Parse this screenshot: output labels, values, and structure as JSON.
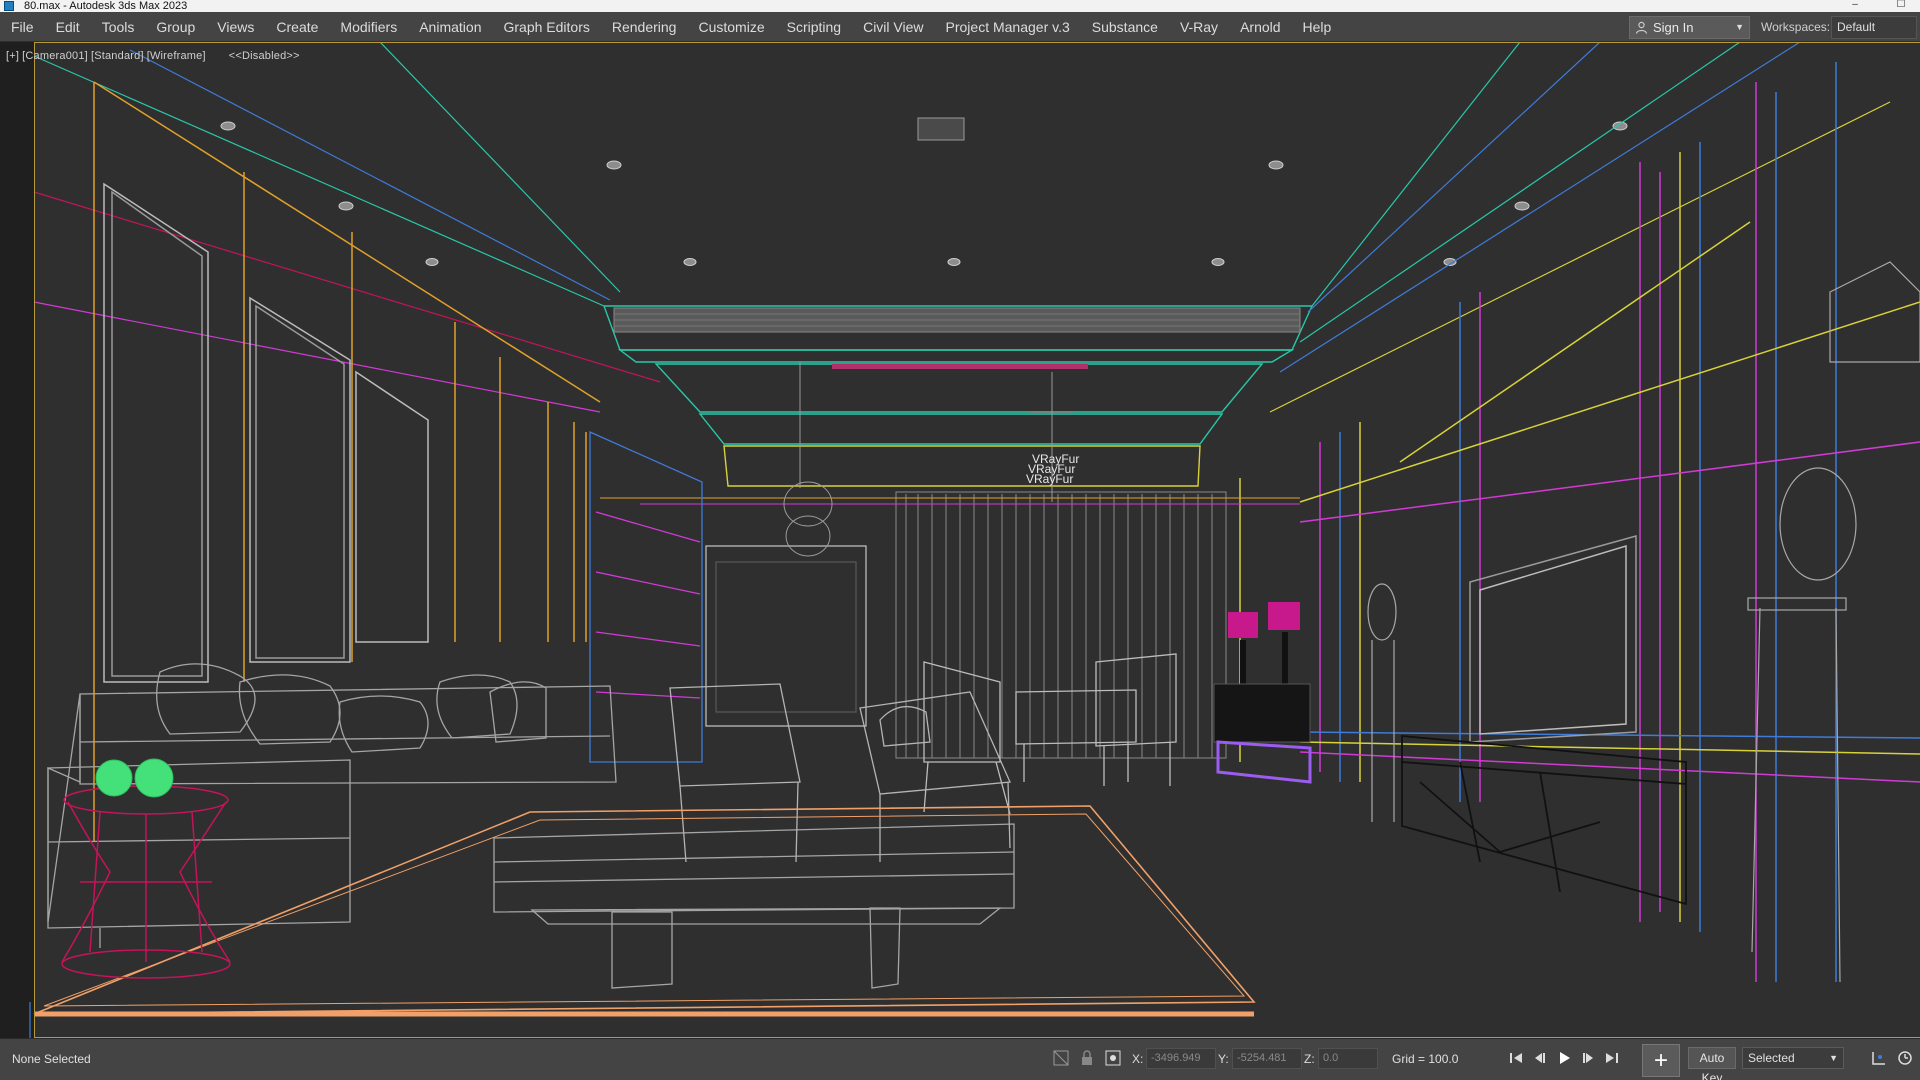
{
  "window": {
    "title": "80.max - Autodesk 3ds Max 2023"
  },
  "menu": {
    "items": [
      "File",
      "Edit",
      "Tools",
      "Group",
      "Views",
      "Create",
      "Modifiers",
      "Animation",
      "Graph Editors",
      "Rendering",
      "Customize",
      "Scripting",
      "Civil View",
      "Project Manager v.3",
      "Substance",
      "V-Ray",
      "Arnold",
      "Help"
    ],
    "sign_in": "Sign In",
    "workspaces_label": "Workspaces:",
    "workspaces_value": "Default"
  },
  "viewport": {
    "label_parts": [
      "[+]",
      "[Camera001]",
      "[Standard]",
      "[Wireframe]",
      "<<Disabled>>"
    ],
    "scene_labels": [
      "VRayFur",
      "VRayFur",
      "VRayFur"
    ],
    "frame_color": "#b59a3a"
  },
  "status": {
    "selection": "None Selected",
    "x_label": "X:",
    "x_value": "-3496.949",
    "y_label": "Y:",
    "y_value": "-5254.481",
    "z_label": "Z:",
    "z_value": "0.0",
    "grid": "Grid = 100.0",
    "auto_key": "Auto Key",
    "key_filter": "Selected"
  },
  "colors": {
    "wall_orange": "#e0a02a",
    "ceiling_cyan": "#29c7a8",
    "magenta": "#d23ad6",
    "blue": "#3f7bd8",
    "yellow": "#d8d23a",
    "furniture_gray": "#9a9a9a",
    "rug_orange": "#f0a068",
    "stool_red": "#c4145a",
    "apple_green": "#44e07a",
    "lamp_magenta": "#c8198c",
    "bench_violet": "#9b5cf0"
  },
  "icons": [
    "user-icon",
    "lock-icon",
    "snap-icon",
    "goto-start-icon",
    "prev-frame-icon",
    "play-icon",
    "next-frame-icon",
    "goto-end-icon",
    "add-key-icon",
    "key-mode-icon",
    "time-config-icon"
  ]
}
